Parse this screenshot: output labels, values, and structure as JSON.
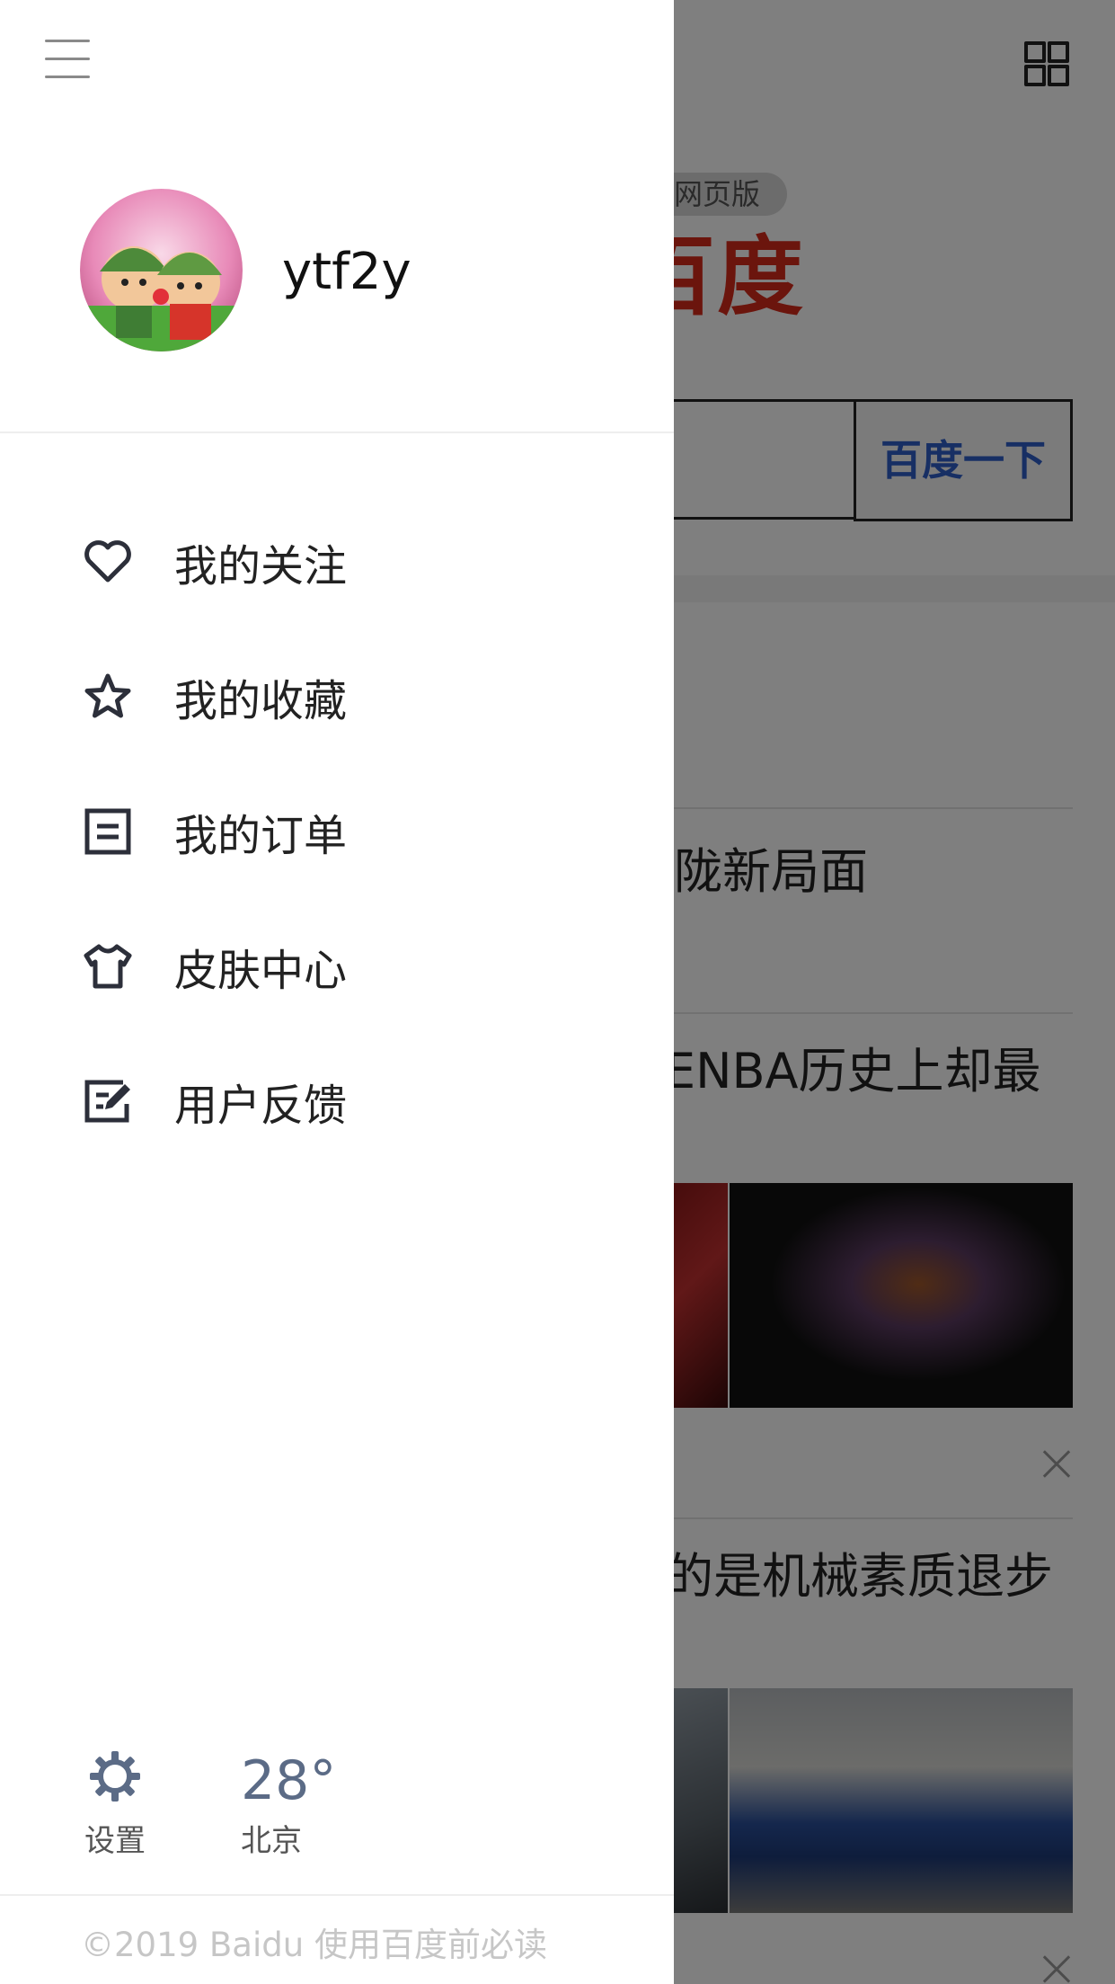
{
  "background": {
    "badge": "网页版",
    "logo": "百度",
    "search_button": "百度一下",
    "news": [
      "陇新局面",
      "ENBA历史上却最",
      "的是机械素质退步"
    ]
  },
  "drawer": {
    "username": "ytf2y",
    "menu": [
      {
        "label": "我的关注",
        "icon": "heart-icon"
      },
      {
        "label": "我的收藏",
        "icon": "star-icon"
      },
      {
        "label": "我的订单",
        "icon": "order-icon"
      },
      {
        "label": "皮肤中心",
        "icon": "tshirt-icon"
      },
      {
        "label": "用户反馈",
        "icon": "feedback-icon"
      }
    ],
    "settings_label": "设置",
    "weather": {
      "temperature": "28°",
      "city": "北京"
    },
    "copyright": "©2019 Baidu 使用百度前必读"
  },
  "colors": {
    "overlay": "#000000",
    "logo_red": "#d62a1a",
    "search_blue": "#2f5fc8",
    "temp": "#5b6b86"
  }
}
